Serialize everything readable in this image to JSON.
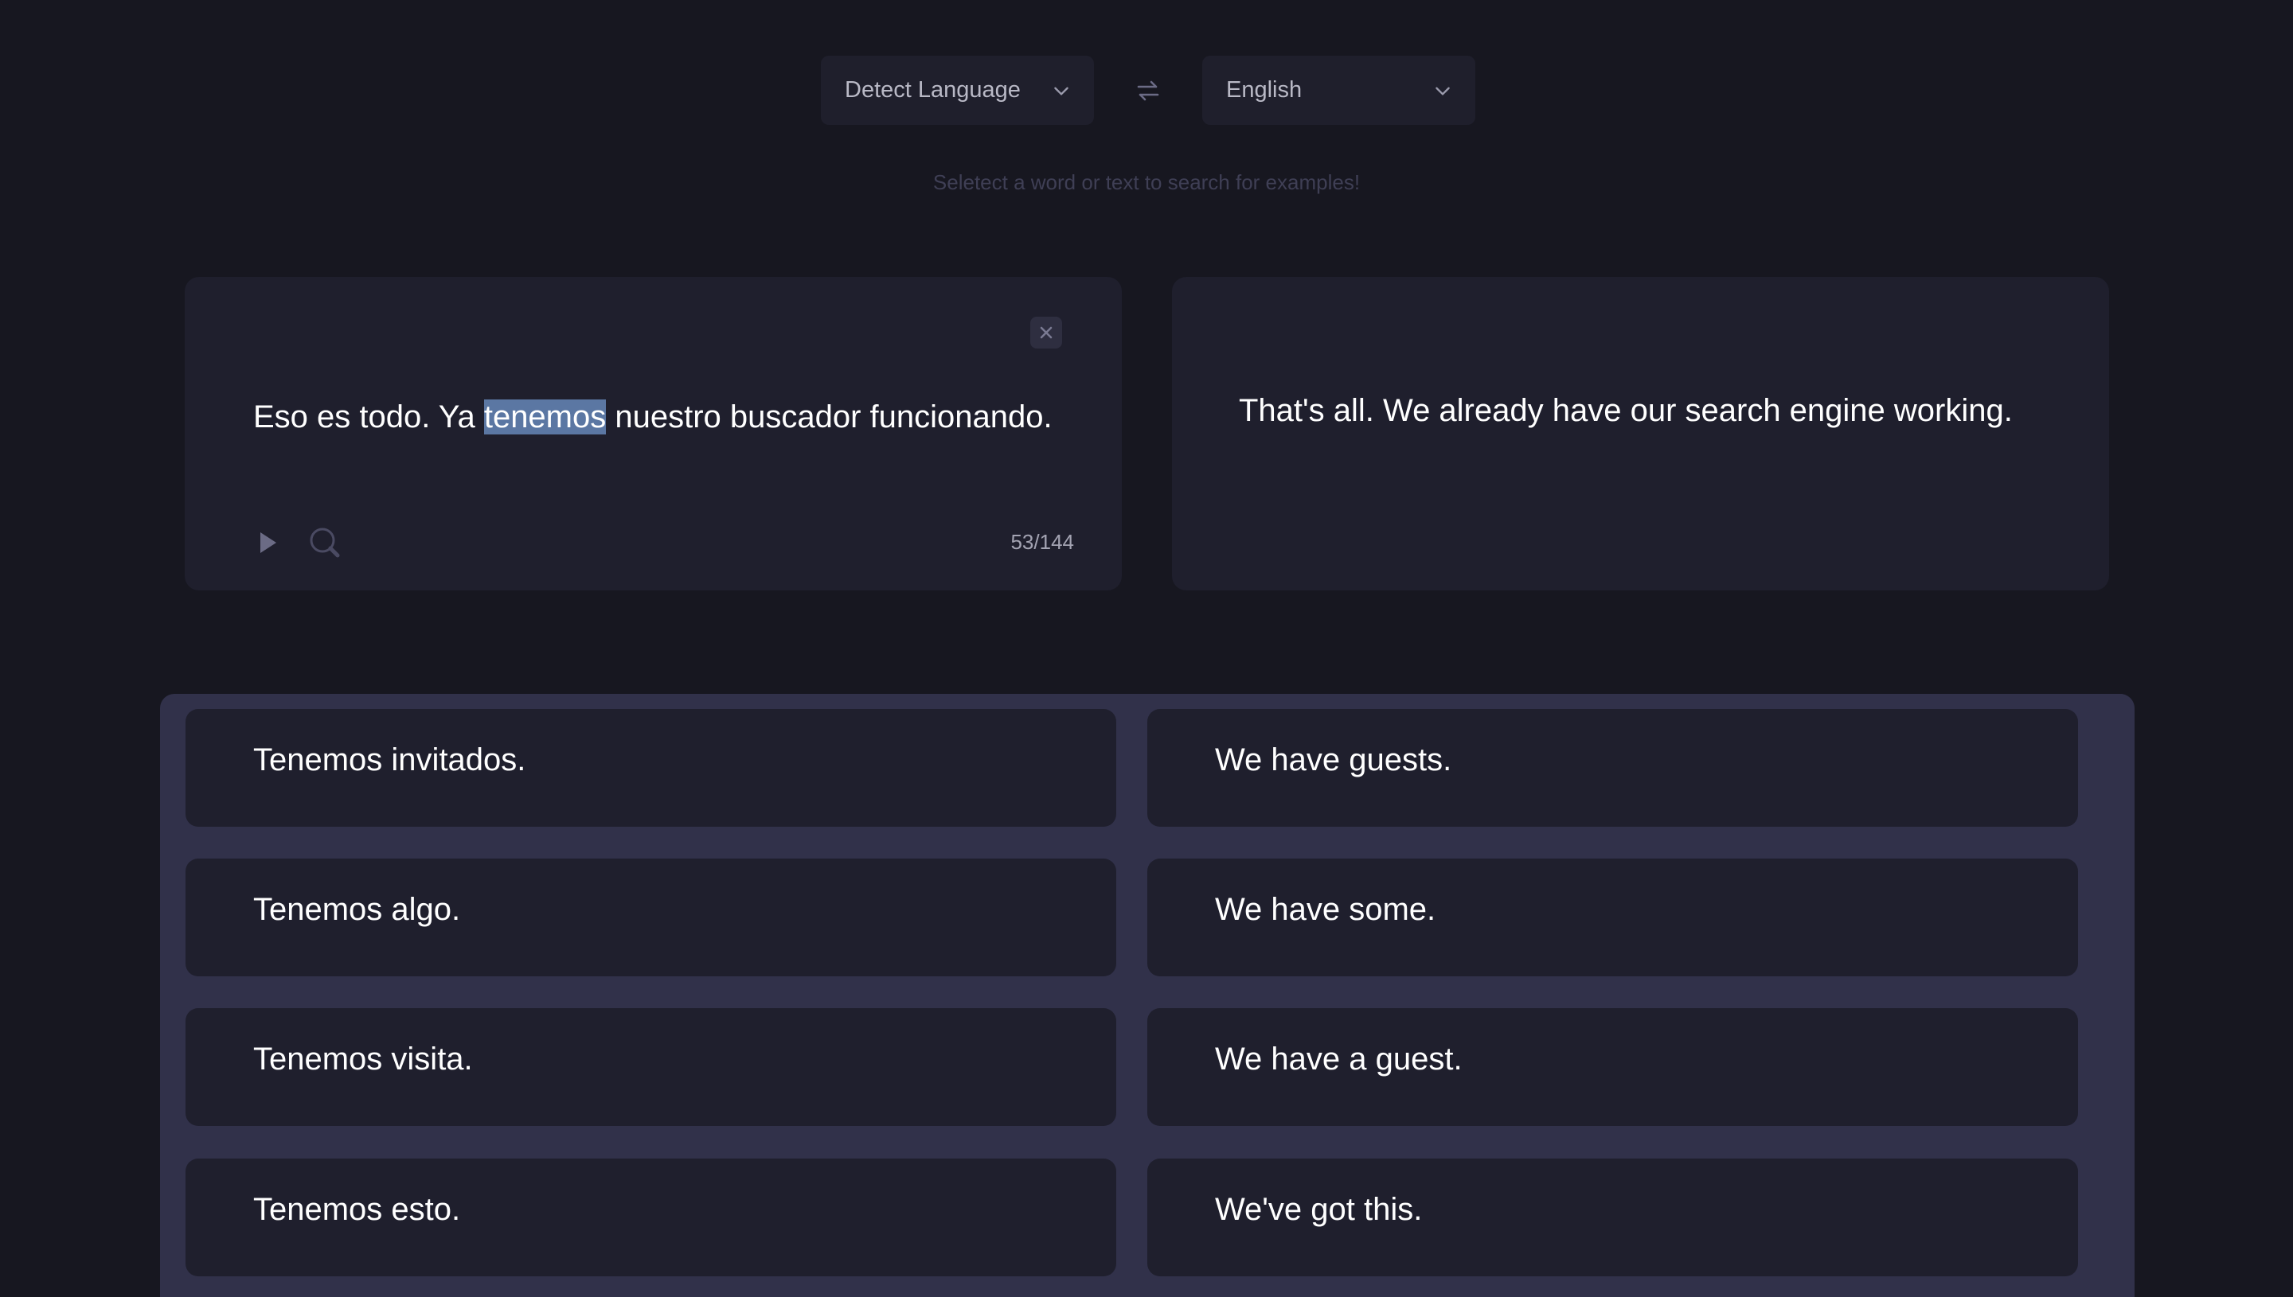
{
  "language_bar": {
    "source_language": "Detect Language",
    "target_language": "English",
    "swap_icon": "swap-arrows-icon",
    "dropdown_icon": "chevron-down-icon"
  },
  "hint": "Seletect a word or text to search for examples!",
  "source_panel": {
    "text_before": "Eso es todo. Ya ",
    "text_selected": "tenemos",
    "text_after": " nuestro buscador funcionando.",
    "char_count": "53/144",
    "icons": [
      "close-icon",
      "play-icon",
      "search-icon"
    ]
  },
  "target_panel": {
    "text": "That's all. We already have our search engine working."
  },
  "examples": [
    {
      "source": "Tenemos invitados.",
      "target": "We have guests."
    },
    {
      "source": "Tenemos algo.",
      "target": "We have some."
    },
    {
      "source": "Tenemos visita.",
      "target": "We have a guest."
    },
    {
      "source": "Tenemos esto.",
      "target": "We've got this."
    }
  ],
  "colors": {
    "background": "#171720",
    "panel": "#1f1f2d",
    "examples_container": "#31314a",
    "selection": "#5b77a3"
  }
}
